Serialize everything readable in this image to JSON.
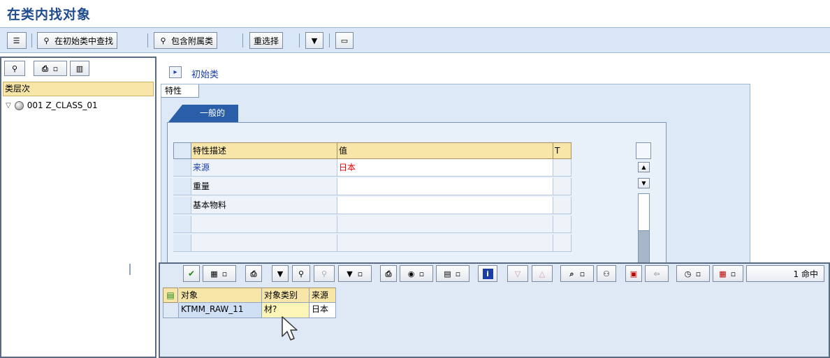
{
  "title": "在类内找对象",
  "toolbar": {
    "find_in_initial": "在初始类中查找",
    "include_subclasses": "包含附属类",
    "reselect": "重选择"
  },
  "left_panel": {
    "tree_header": "类层次",
    "node_label": "001 Z_CLASS_01"
  },
  "main": {
    "initial_class_link": "初始类",
    "char_tab": "特性",
    "general_tab": "一般的",
    "grid": {
      "headers": [
        "特性描述",
        "值",
        "T"
      ],
      "rows": [
        {
          "desc": "来源",
          "value": "日本"
        },
        {
          "desc": "重量",
          "value": ""
        },
        {
          "desc": "基本物料",
          "value": ""
        },
        {
          "desc": "",
          "value": ""
        },
        {
          "desc": "",
          "value": ""
        },
        {
          "desc": "",
          "value": ""
        }
      ]
    }
  },
  "results": {
    "hit_count": "1 命中",
    "headers": [
      "对象",
      "对象类别",
      "来源"
    ],
    "rows": [
      {
        "object": "KTMM_RAW_11",
        "category": "材?",
        "source": "日本"
      }
    ]
  },
  "colors": {
    "accent_blue": "#2a5ea8",
    "header_yellow": "#f7e6a8",
    "value_red": "#e00000",
    "link_blue": "#1a3ea8"
  }
}
